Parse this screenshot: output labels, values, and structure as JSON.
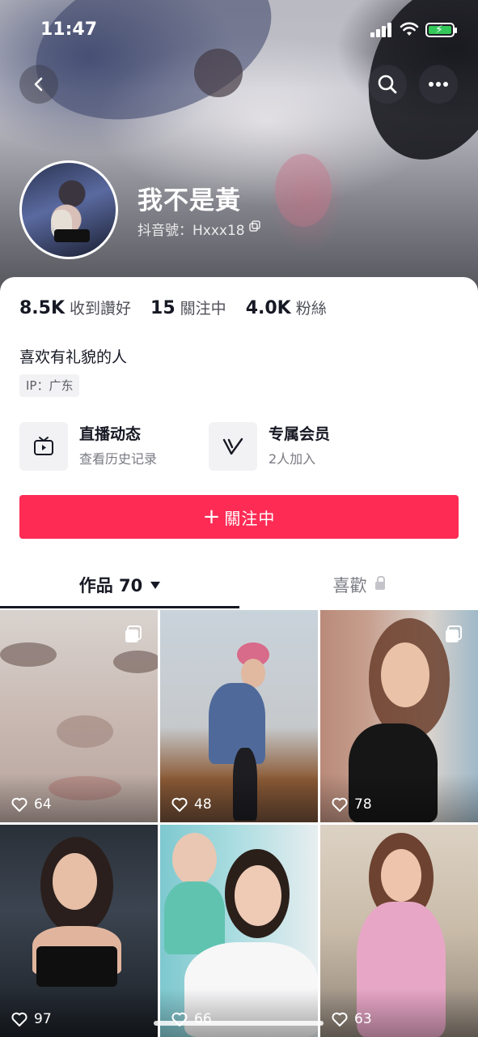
{
  "status_bar": {
    "time": "11:47"
  },
  "profile": {
    "name": "我不是黃",
    "douyin_id": "抖音號：Hxxx18"
  },
  "stats": [
    {
      "value": "8.5K",
      "label": "收到讚好"
    },
    {
      "value": "15",
      "label": "關注中"
    },
    {
      "value": "4.0K",
      "label": "粉絲"
    }
  ],
  "bio": "喜欢有礼貌的人",
  "ip_location": "IP：广东",
  "features": [
    {
      "title": "直播动态",
      "subtitle": "查看历史记录",
      "icon": "tv-icon"
    },
    {
      "title": "专属会员",
      "subtitle": "2人加入",
      "icon": "vip-v-icon"
    }
  ],
  "follow_button": {
    "label": "關注中",
    "color": "#fe2c55"
  },
  "tabs": [
    {
      "label": "作品 70",
      "active": true
    },
    {
      "label": "喜歡",
      "active": false,
      "locked": true
    }
  ],
  "videos": [
    {
      "likes": "64",
      "pinned": true
    },
    {
      "likes": "48",
      "pinned": false
    },
    {
      "likes": "78",
      "pinned": true
    },
    {
      "likes": "97",
      "pinned": false
    },
    {
      "likes": "66",
      "pinned": false
    },
    {
      "likes": "63",
      "pinned": false
    }
  ]
}
